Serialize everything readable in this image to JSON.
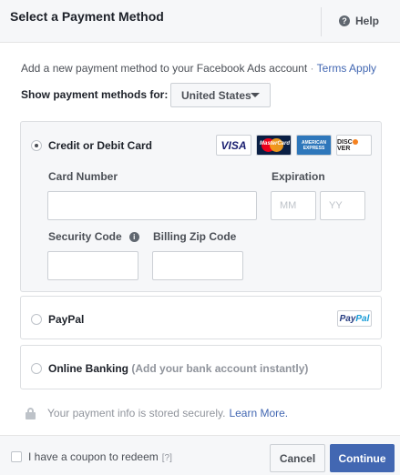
{
  "header": {
    "title": "Select a Payment Method",
    "help_label": "Help",
    "help_glyph": "?"
  },
  "intro": {
    "text": "Add a new payment method to your Facebook Ads account",
    "separator": "·",
    "link": "Terms Apply"
  },
  "country": {
    "label": "Show payment methods for:",
    "selected": "United States"
  },
  "card_option": {
    "label": "Credit or Debit Card",
    "selected": true,
    "logos": {
      "visa": "VISA",
      "mastercard": "MasterCard",
      "amex_line1": "AMERICAN",
      "amex_line2": "EXPRESS",
      "discover_a": "DISC",
      "discover_b": "VER"
    },
    "card_number": {
      "label": "Card Number",
      "value": ""
    },
    "expiration": {
      "label": "Expiration",
      "month_placeholder": "MM",
      "year_placeholder": "YY"
    },
    "security_code": {
      "label": "Security Code",
      "info_glyph": "i",
      "value": ""
    },
    "zip_code": {
      "label": "Billing Zip Code",
      "value": ""
    }
  },
  "paypal_option": {
    "label": "PayPal",
    "selected": false,
    "logo_pay": "Pay",
    "logo_pal": "Pal"
  },
  "banking_option": {
    "label": "Online Banking",
    "sublabel": "(Add your bank account instantly)",
    "selected": false
  },
  "secure_note": {
    "text": "Your payment info is stored securely.",
    "link": "Learn More."
  },
  "footer": {
    "coupon_label": "I have a coupon to redeem",
    "coupon_help": "[?]",
    "cancel_label": "Cancel",
    "continue_label": "Continue"
  },
  "colors": {
    "accent": "#4267b2",
    "panel_bg": "#f6f7f9",
    "border": "#dddfe2"
  }
}
